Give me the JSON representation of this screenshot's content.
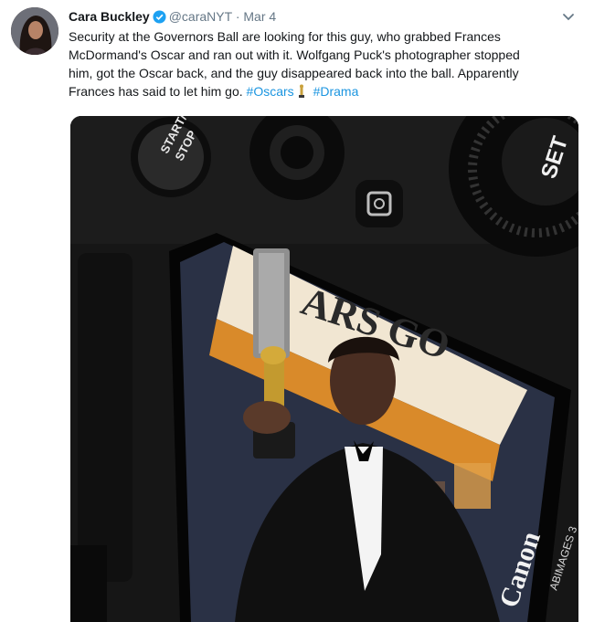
{
  "tweet": {
    "author_name": "Cara Buckley",
    "handle": "@caraNYT",
    "separator": "·",
    "date": "Mar 4",
    "text_lines": [
      "Security at the Governors Ball are looking for this guy, who grabbed Frances",
      "McDormand's Oscar and ran out with it. Wolfgang Puck's photographer stopped",
      "him, got the Oscar back, and the guy disappeared back into the ball. Apparently"
    ],
    "text_last_line": "Frances has said to let him go.",
    "hashtags": [
      "#Oscars",
      "#Drama"
    ],
    "colors": {
      "link": "#1b95e0",
      "verified": "#1da1f2",
      "meta": "#657786"
    }
  },
  "photo": {
    "camera_buttons": {
      "start_stop": [
        "START/",
        "STOP"
      ],
      "set": "SET"
    },
    "screen_sign_text": "ARS GO",
    "brand": "Canon",
    "watermark": "ABIMAGES 3"
  }
}
